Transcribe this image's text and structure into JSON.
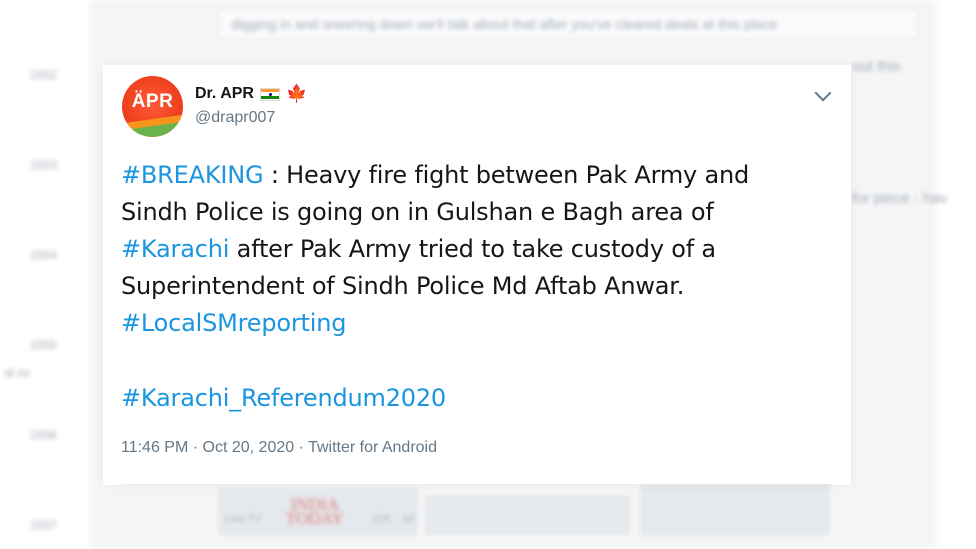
{
  "background": {
    "input_text": "digging in and sneering down we'll talk about that after you've cleared deals at this place",
    "right_text_1": "out this",
    "right_text_2": "for piece - hav",
    "times": [
      "1552",
      "1553",
      "1554",
      "1555",
      "1556",
      "1557"
    ],
    "left_small": "st ro",
    "logo_line1": "INDIA",
    "logo_line2": "TODAY",
    "small_1": "Live TV",
    "small_2": "22K",
    "small_3": "44"
  },
  "tweet": {
    "avatar_text": "ÄPR",
    "display_name": "Dr. APR",
    "handle": "@drapr007",
    "text": {
      "hashtag_breaking": "#BREAKING",
      "line1_rest": " : Heavy fire fight between Pak Army and",
      "line2": "Sindh Police is going on in Gulshan e Bagh area of",
      "hashtag_karachi": "#Karachi",
      "line3_rest": " after Pak Army tried to take custody of a",
      "line4": "Superintendent of Sindh Police Md Aftab Anwar.",
      "hashtag_local": "#LocalSMreporting",
      "hashtag_referendum": "#Karachi_Referendum2020"
    },
    "meta": "11:46 PM · Oct 20, 2020 · Twitter for Android",
    "flag_icons": [
      "india-flag-icon",
      "canada-maple-leaf-icon"
    ],
    "colors": {
      "hashtag": "#1b95e0",
      "text": "#14171a",
      "secondary": "#657786"
    }
  }
}
